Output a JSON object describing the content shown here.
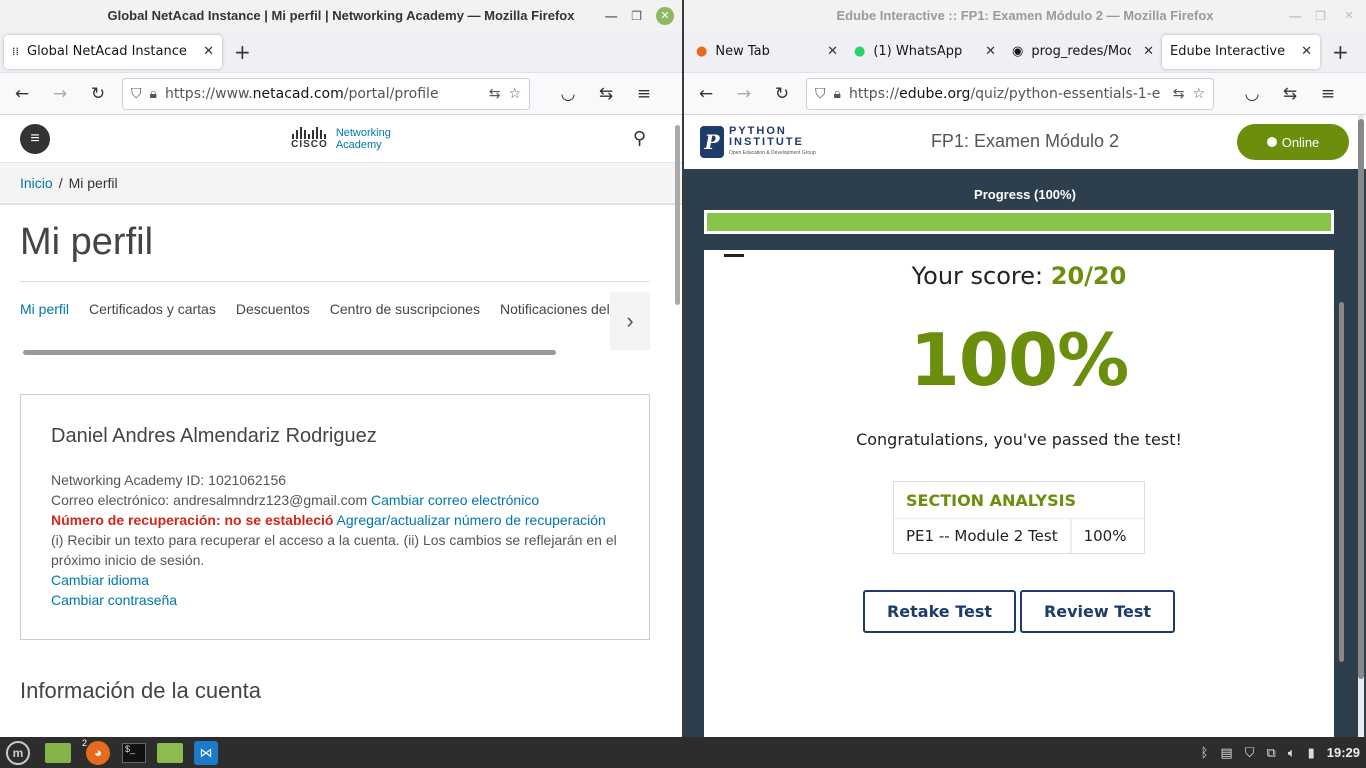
{
  "left": {
    "window_title": "Global NetAcad Instance | Mi perfil | Networking Academy — Mozilla Firefox",
    "tab_title": "Global NetAcad Instance | M",
    "url_prefix": "https://www.",
    "url_domain": "netacad.com",
    "url_path": "/portal/profile",
    "logo_brand": "CISCO",
    "logo_line1": "Networking",
    "logo_line2": "Academy",
    "breadcrumb_home": "Inicio",
    "breadcrumb_sep": "/",
    "breadcrumb_current": "Mi perfil",
    "page_title": "Mi perfil",
    "profile_tabs": [
      "Mi perfil",
      "Certificados y cartas",
      "Descuentos",
      "Centro de suscripciones",
      "Notificaciones del cu"
    ],
    "user_name": "Daniel Andres Almendariz Rodriguez",
    "id_label": "Networking Academy ID: 1021062156",
    "email_label": "Correo electrónico: andresalmndrz123@gmail.com",
    "change_email": "Cambiar correo electrónico",
    "recovery_label": "Número de recuperación: no se estableció",
    "recovery_link": "Agregar/actualizar número de recuperación",
    "recovery_note": "(i) Recibir un texto para recuperar el acceso a la cuenta. (ii) Los cambios se reflejarán en el próximo inicio de sesión.",
    "change_language": "Cambiar idioma",
    "change_password": "Cambiar contraseña",
    "account_info": "Información de la cuenta"
  },
  "right": {
    "window_title": "Edube Interactive :: FP1: Examen Módulo 2 — Mozilla Firefox",
    "tabs": [
      {
        "title": "New Tab"
      },
      {
        "title": "(1) WhatsApp"
      },
      {
        "title": "prog_redes/Mod"
      },
      {
        "title": "Edube Interactive :: F"
      }
    ],
    "url_prefix": "https://",
    "url_domain": "edube.org",
    "url_path": "/quiz/python-essentials-1-e",
    "logo_line1": "PYTHON",
    "logo_line2": "INSTITUTE",
    "logo_tagline": "Open Education & Development Group",
    "page_title": "FP1: Examen Módulo 2",
    "online_label": "Online",
    "progress_label": "Progress (100%)",
    "progress_fraction": 1.0,
    "score_label": "Your score:",
    "score_value": "20/20",
    "percent": "100%",
    "congrats": "Congratulations, you've passed the test!",
    "section_header": "SECTION ANALYSIS",
    "section_name": "PE1 -- Module 2 Test",
    "section_value": "100%",
    "retake_label": "Retake Test",
    "review_label": "Review Test"
  },
  "taskbar": {
    "firefox_badge": "2",
    "clock": "19:29"
  },
  "colors": {
    "accent_green": "#6b8e0c",
    "progress_green": "#88c34b",
    "page_dark": "#2d3e4c",
    "netacad_link": "#0076ae",
    "error_red": "#d0271d"
  }
}
